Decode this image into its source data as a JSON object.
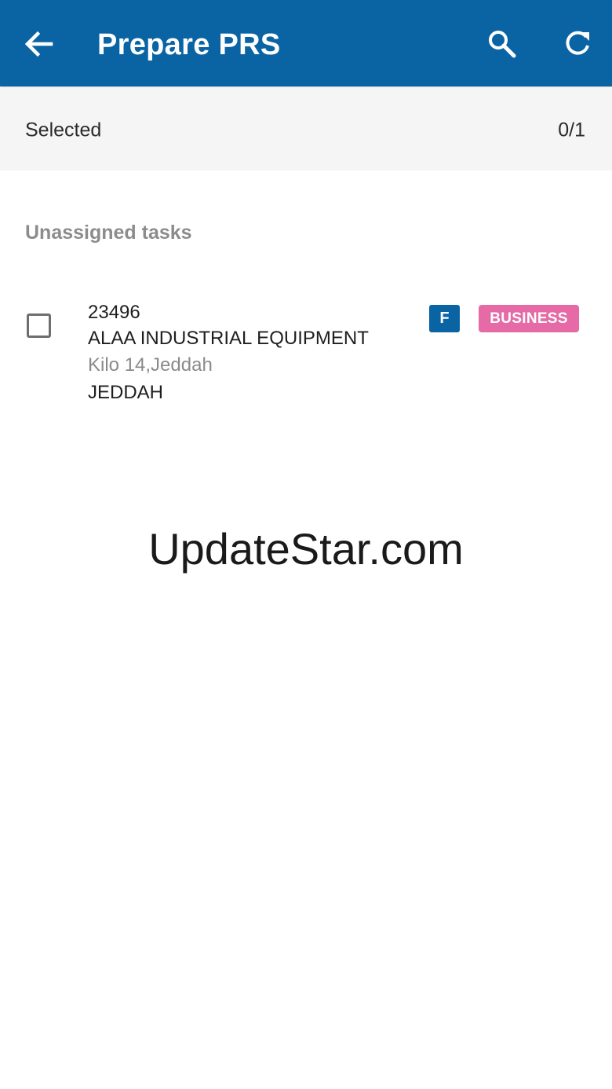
{
  "app_bar": {
    "title": "Prepare PRS",
    "back_icon": "arrow-left-icon",
    "search_icon": "search-icon",
    "refresh_icon": "refresh-icon",
    "background_color": "#0a64a4"
  },
  "selection": {
    "label": "Selected",
    "count": "0/1"
  },
  "section": {
    "title": "Unassigned tasks"
  },
  "tasks": [
    {
      "id": "23496",
      "name": "ALAA INDUSTRIAL EQUIPMENT",
      "address": "Kilo 14,Jeddah",
      "city": "JEDDAH",
      "checked": false,
      "badges": [
        {
          "label": "F",
          "color": "#0a64a4"
        },
        {
          "label": "BUSINESS",
          "color": "#e56aa6"
        }
      ]
    }
  ],
  "watermark": "UpdateStar.com"
}
